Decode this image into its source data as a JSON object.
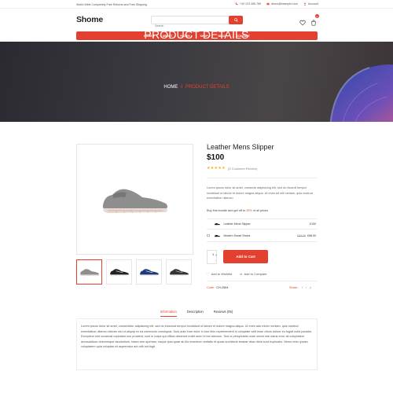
{
  "topbar": {
    "shipping_text": "World Wide Completely Free Returns and Free Shipping",
    "phone": "+00 123 456 789",
    "email": "demo@example.com",
    "account": "Account"
  },
  "header": {
    "logo": "Shome",
    "search": {
      "placeholder": "Search"
    },
    "cart_count": "0",
    "icons": [
      "search-icon",
      "heart-icon",
      "cart-icon"
    ]
  },
  "nav": {
    "items": [
      "HOME",
      "ABOUT",
      "PAGES",
      "SHOP",
      "BLOG",
      "CONTACT"
    ]
  },
  "banner": {
    "title": "PRODUCT DETAILS",
    "crumb_home": "HOME",
    "crumb_sep": "//",
    "crumb_current": "PRODUCT DETAILS"
  },
  "product": {
    "title": "Leather Mens Slipper",
    "price": "$100",
    "stars": "★★★★★",
    "reviews": "(3 Customer Review)",
    "description": "Lorem ipsum dolor sit amet, consecte adipisicing elit, sed do eiusmll tempor incididunt ut labore et dolore magna aliqua. Ut enim ad mill veniam, quis nostrud exercitation ullamco",
    "bundle_prefix": "Buy this bundle and get off to",
    "bundle_pct": "25%",
    "bundle_suffix": "of all prices",
    "bundle_items": [
      {
        "name": "Leather Mens Slipper",
        "old": "",
        "price": "£100"
      },
      {
        "name": "Modern Smart Shoes",
        "old": "£58.00",
        "price": "£68.00"
      }
    ],
    "qty": "1",
    "add_to_cart": "Add to Cart",
    "wishlist": "Add to Wishlist",
    "compare": "Add to Compare",
    "code_label": "Code :",
    "code_value": "CH-2564",
    "share_label": "Share :"
  },
  "tabs": {
    "items": [
      "Information",
      "Description",
      "Reviews (05)"
    ],
    "active": "Information",
    "content": "Lorem ipsum dolor sit amet, consectetur adipisicing elit, sed do eiusmod tempor incididunt ut labore et dolore magna aliqua. Ut enim ado minim veniam, quis nostrud exercitation ullamco laboris nisi ut aliquip ex ea commodo consequat. Duis aute irure dolor in ture finis reprehenderit in voluptate velit esse cillum dolore eu fugiat nulla pariatur. Excepteur sint occaecat cupidatat non proident, sunt in culpa qui officia deserunt mollit anim id est laborum. Sed ut perspiciatis unde omnis iste natus error sit voluptatem accusantium doloremque laudantium, totam rem aperiam, eaque ipsa quae ab illo inventore veritatis et quasi architecto beatae vitae dicta sunt explicabo. Nemo enim ipsam voluptatem quia voluptas sit aspernatur aut odit aut fugit."
  },
  "colors": {
    "accent": "#e4402f",
    "star": "#f2b01e",
    "banner_bg": "#2b2a30"
  }
}
